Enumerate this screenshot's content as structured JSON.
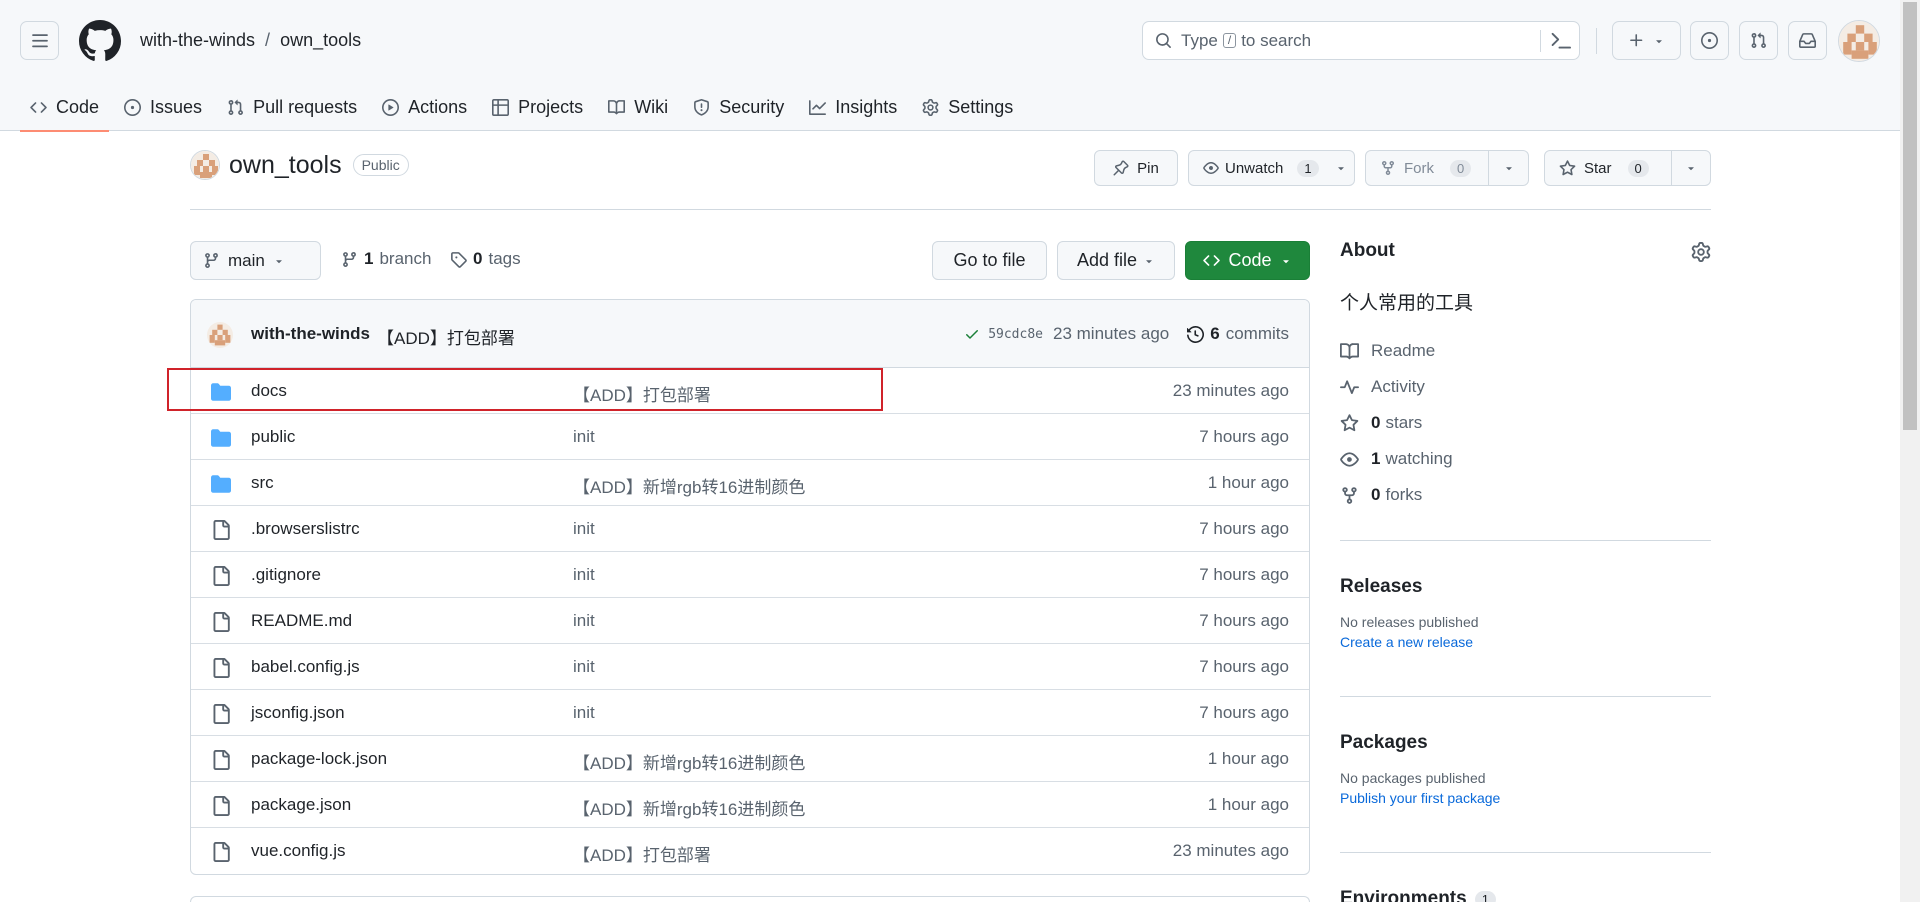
{
  "header": {
    "owner": "with-the-winds",
    "separator": "/",
    "repo": "own_tools",
    "search": {
      "before": "Type",
      "key": "/",
      "after": "to search"
    }
  },
  "tabs": [
    {
      "label": "Code",
      "icon": "code-icon",
      "active": true
    },
    {
      "label": "Issues",
      "icon": "issue-opened-icon"
    },
    {
      "label": "Pull requests",
      "icon": "git-pull-request-icon"
    },
    {
      "label": "Actions",
      "icon": "play-icon"
    },
    {
      "label": "Projects",
      "icon": "table-icon"
    },
    {
      "label": "Wiki",
      "icon": "book-icon"
    },
    {
      "label": "Security",
      "icon": "shield-icon"
    },
    {
      "label": "Insights",
      "icon": "graph-icon"
    },
    {
      "label": "Settings",
      "icon": "gear-icon"
    }
  ],
  "repo_head": {
    "name": "own_tools",
    "visibility": "Public",
    "pin": "Pin",
    "unwatch": "Unwatch",
    "watch_count": "1",
    "fork": "Fork",
    "fork_count": "0",
    "star": "Star",
    "star_count": "0"
  },
  "branch_bar": {
    "branch": "main",
    "branch_count": "1",
    "branch_label": "branch",
    "tag_count": "0",
    "tag_label": "tags",
    "go_to_file": "Go to file",
    "add_file": "Add file",
    "code": "Code"
  },
  "commit": {
    "author": "with-the-winds",
    "message": "【ADD】打包部署",
    "sha": "59cdc8e",
    "time": "23 minutes ago",
    "commit_count": "6",
    "commit_label": "commits",
    "status_color": "#1a7f37"
  },
  "files": [
    {
      "name": "docs",
      "type": "dir",
      "message": "【ADD】打包部署",
      "time": "23 minutes ago"
    },
    {
      "name": "public",
      "type": "dir",
      "message": "init",
      "time": "7 hours ago"
    },
    {
      "name": "src",
      "type": "dir",
      "message": "【ADD】新增rgb转16进制颜色",
      "time": "1 hour ago"
    },
    {
      "name": ".browserslistrc",
      "type": "file",
      "message": "init",
      "time": "7 hours ago"
    },
    {
      "name": ".gitignore",
      "type": "file",
      "message": "init",
      "time": "7 hours ago"
    },
    {
      "name": "README.md",
      "type": "file",
      "message": "init",
      "time": "7 hours ago"
    },
    {
      "name": "babel.config.js",
      "type": "file",
      "message": "init",
      "time": "7 hours ago"
    },
    {
      "name": "jsconfig.json",
      "type": "file",
      "message": "init",
      "time": "7 hours ago"
    },
    {
      "name": "package-lock.json",
      "type": "file",
      "message": "【ADD】新增rgb转16进制颜色",
      "time": "1 hour ago"
    },
    {
      "name": "package.json",
      "type": "file",
      "message": "【ADD】新增rgb转16进制颜色",
      "time": "1 hour ago"
    },
    {
      "name": "vue.config.js",
      "type": "file",
      "message": "【ADD】打包部署",
      "time": "23 minutes ago"
    }
  ],
  "about": {
    "title": "About",
    "description": "个人常用的工具",
    "readme": "Readme",
    "activity": "Activity",
    "stars_count": "0",
    "stars_label": "stars",
    "watching_count": "1",
    "watching_label": "watching",
    "forks_count": "0",
    "forks_label": "forks"
  },
  "releases": {
    "title": "Releases",
    "empty": "No releases published",
    "link": "Create a new release"
  },
  "packages": {
    "title": "Packages",
    "empty": "No packages published",
    "link": "Publish your first package"
  },
  "environments": {
    "title": "Environments",
    "count": "1"
  },
  "colors": {
    "accent_green": "#1f883d",
    "link_blue": "#0969da",
    "tab_underline": "#fd8c73",
    "folder_blue": "#54aeff",
    "highlight_red": "#d0232a"
  }
}
